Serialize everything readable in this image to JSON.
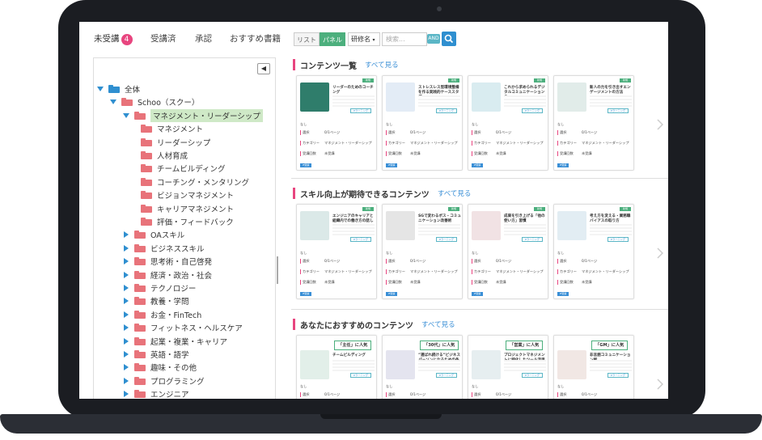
{
  "tabs": [
    {
      "label": "未受講",
      "badge": "4"
    },
    {
      "label": "受講済"
    },
    {
      "label": "承認"
    },
    {
      "label": "おすすめ書籍"
    }
  ],
  "view_toggle": {
    "list": "リスト",
    "panel": "パネル"
  },
  "search": {
    "select_value": "研修名",
    "placeholder": "検索...",
    "and_label": "AND"
  },
  "tree": [
    {
      "label": "全体",
      "level": 0,
      "open": true,
      "color": "#2f8fd0"
    },
    {
      "label": "Schoo（スクー）",
      "level": 1,
      "open": true,
      "color": "#e8737a"
    },
    {
      "label": "マネジメント・リーダーシップ",
      "level": 2,
      "open": true,
      "color": "#e8737a",
      "selected": true
    },
    {
      "label": "マネジメント",
      "level": 3,
      "color": "#e8737a"
    },
    {
      "label": "リーダーシップ",
      "level": 3,
      "color": "#e8737a"
    },
    {
      "label": "人材育成",
      "level": 3,
      "color": "#e8737a"
    },
    {
      "label": "チームビルディング",
      "level": 3,
      "color": "#e8737a"
    },
    {
      "label": "コーチング・メンタリング",
      "level": 3,
      "color": "#e8737a"
    },
    {
      "label": "ビジョンマネジメント",
      "level": 3,
      "color": "#e8737a"
    },
    {
      "label": "キャリアマネジメント",
      "level": 3,
      "color": "#e8737a"
    },
    {
      "label": "評価・フィードバック",
      "level": 3,
      "color": "#e8737a"
    },
    {
      "label": "OAスキル",
      "level": 2,
      "color": "#e8737a"
    },
    {
      "label": "ビジネススキル",
      "level": 2,
      "color": "#e8737a"
    },
    {
      "label": "思考術・自己啓発",
      "level": 2,
      "color": "#e8737a"
    },
    {
      "label": "経済・政治・社会",
      "level": 2,
      "color": "#e8737a"
    },
    {
      "label": "テクノロジー",
      "level": 2,
      "color": "#e8737a"
    },
    {
      "label": "教養・学問",
      "level": 2,
      "color": "#e8737a"
    },
    {
      "label": "お金・FinTech",
      "level": 2,
      "color": "#e8737a"
    },
    {
      "label": "フィットネス・ヘルスケア",
      "level": 2,
      "color": "#e8737a"
    },
    {
      "label": "起業・複業・キャリア",
      "level": 2,
      "color": "#e8737a"
    },
    {
      "label": "英語・語学",
      "level": 2,
      "color": "#e8737a"
    },
    {
      "label": "趣味・その他",
      "level": 2,
      "color": "#e8737a"
    },
    {
      "label": "プログラミング",
      "level": 2,
      "color": "#e8737a"
    },
    {
      "label": "エンジニア",
      "level": 2,
      "color": "#e8737a"
    }
  ],
  "sections": [
    {
      "title": "コンテンツ一覧",
      "see_all": "すべて見る",
      "cards": [
        {
          "title": "リーダーのためのコーチング",
          "thumb": "#2f7d6b",
          "popular": ""
        },
        {
          "title": "ストレスレス型環境整備を作る実践的ケーススタディ",
          "thumb": "#e3ecf6",
          "popular": ""
        },
        {
          "title": "これから求められるデジタルコミュニケーションの",
          "thumb": "#d9ecf0",
          "popular": ""
        },
        {
          "title": "新人の力を引き出すエンゲージメントの方法",
          "thumb": "#e1ece9",
          "popular": ""
        }
      ]
    },
    {
      "title": "スキル向上が期待できるコンテンツ",
      "see_all": "すべて見る",
      "cards": [
        {
          "title": "エンジニアのキャリアと組織内での働き方の話し",
          "thumb": "#dbe9e8",
          "popular": ""
        },
        {
          "title": "SGで変わるボス・コミュニケーション改善術",
          "thumb": "#e5e5e5",
          "popular": ""
        },
        {
          "title": "成果を引き上げる「他の使い方」習慣",
          "thumb": "#f1e2e4",
          "popular": ""
        },
        {
          "title": "考え方を変える・業務職バイアスの取り方",
          "thumb": "#e2edf3",
          "popular": ""
        }
      ]
    },
    {
      "title": "あなたにおすすめのコンテンツ",
      "see_all": "すべて見る",
      "cards": [
        {
          "title": "チームビルディング",
          "thumb": "#e2efe9",
          "popular": "「主任」に人気"
        },
        {
          "title": "”選ばれ続ける”ビジネスパーソンになるための条",
          "thumb": "#e4e4ef",
          "popular": "「30代」に人気"
        },
        {
          "title": "プロジェクトマネジメントに特化したツール活用",
          "thumb": "#e6eef0",
          "popular": "「営業」に人気"
        },
        {
          "title": "非言語コミュニケーション術",
          "thumb": "#f1e7e4",
          "popular": "「GM」に人気"
        }
      ]
    }
  ],
  "card_meta": {
    "green_tag": "新規",
    "elearning": "eラーニング",
    "nashi": "なし",
    "sel_label": "選択",
    "pages": "0/1ページ",
    "category_label": "カテゴリー",
    "category_value": "マネジメント・リーダーシップ",
    "count_label": "受講回数",
    "count_value": "未受講",
    "type_tag": "IF受講"
  }
}
